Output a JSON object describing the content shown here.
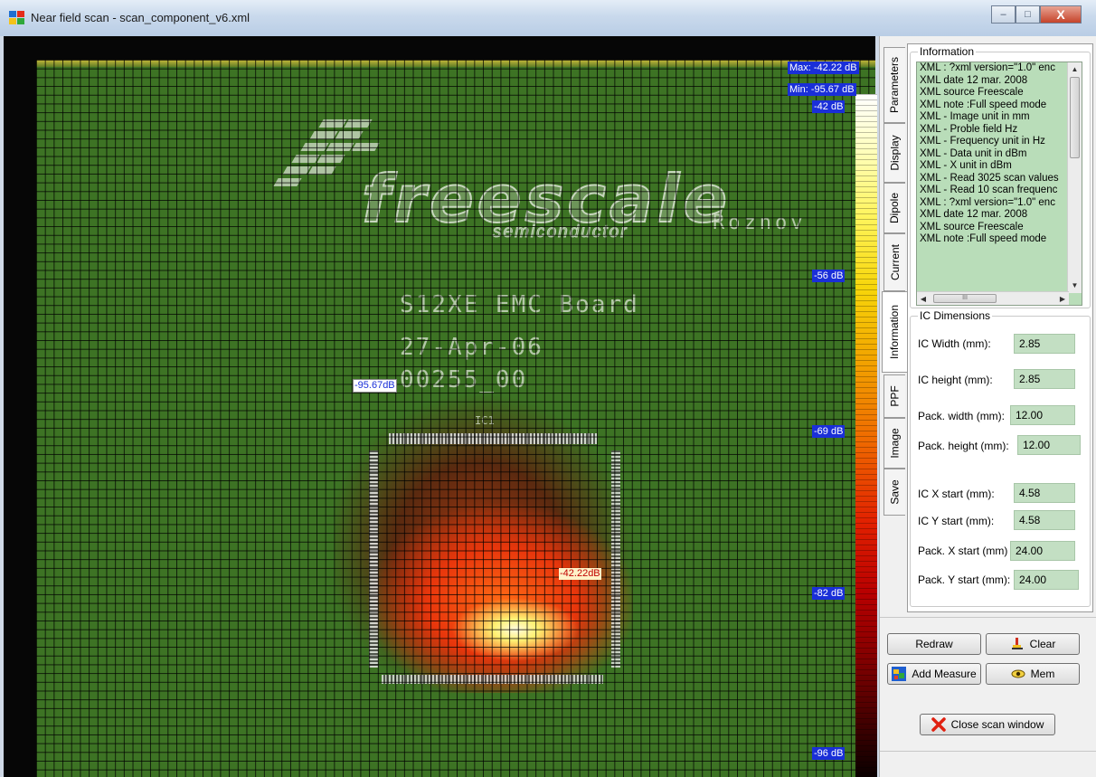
{
  "window": {
    "title": "Near field scan - scan_component_v6.xml",
    "min_label": "–",
    "max_label": "□",
    "close_label": "X"
  },
  "scan": {
    "max_label": "Max: -42.22 dB",
    "min_label": "Min: -95.67 dB",
    "scale_labels": [
      "-42 dB",
      "-56 dB",
      "-69 dB",
      "-82 dB",
      "-96 dB"
    ],
    "min_marker": "-95.67dB",
    "max_marker": "-42.22dB",
    "board_text": {
      "brand": "freescale",
      "brand_sub": "semiconductor",
      "location": "Roznov",
      "board_name": "S12XE  EMC  Board",
      "date": "27-Apr-06",
      "serial": "00255_00",
      "ref": "IC1"
    }
  },
  "tabs": [
    "Parameters",
    "Display",
    "Dipole",
    "Current",
    "Information",
    "PPF",
    "Image",
    "Save"
  ],
  "active_tab": "Information",
  "information": {
    "group_title": "Information",
    "lines": [
      "XML : ?xml version=\"1.0\" enc",
      "XML date 12 mar. 2008",
      "XML source Freescale",
      "XML note :Full speed mode",
      "XML - Image unit in mm",
      "XML - Proble field Hz",
      "XML - Frequency unit in Hz",
      "XML - Data unit in dBm",
      "XML - X unit in dBm",
      "XML - Read 3025 scan values",
      "XML - Read 10 scan frequenc",
      "XML : ?xml version=\"1.0\" enc",
      "XML date 12 mar. 2008",
      "XML source Freescale",
      "XML note :Full speed mode"
    ],
    "hscroll_grip": "III"
  },
  "ic_dimensions": {
    "group_title": "IC Dimensions",
    "fields": [
      {
        "label": "IC Width (mm):",
        "value": "2.85"
      },
      {
        "label": "IC height (mm):",
        "value": "2.85"
      },
      {
        "label": "Pack. width (mm):",
        "value": "12.00"
      },
      {
        "label": "Pack. height (mm):",
        "value": "12.00"
      },
      {
        "label": "IC X start (mm):",
        "value": "4.58"
      },
      {
        "label": "IC Y start (mm):",
        "value": "4.58"
      },
      {
        "label": "Pack. X start (mm)",
        "value": "24.00"
      },
      {
        "label": "Pack. Y start (mm):",
        "value": "24.00"
      }
    ]
  },
  "buttons": {
    "redraw": "Redraw",
    "clear": "Clear",
    "add_measure": "Add Measure",
    "mem": "Mem",
    "close_scan": "Close scan window"
  }
}
